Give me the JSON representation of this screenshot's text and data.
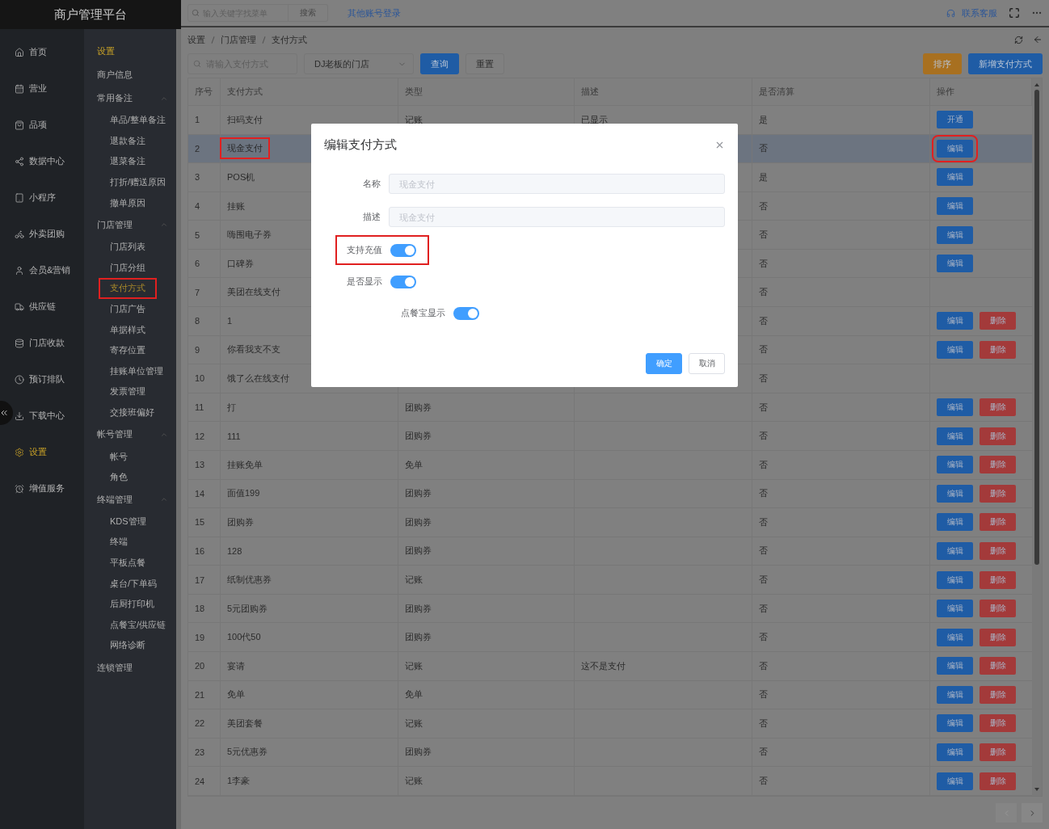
{
  "app_title": "商户管理平台",
  "nav": [
    {
      "label": "首页",
      "selected": false
    },
    {
      "label": "营业",
      "selected": false
    },
    {
      "label": "品项",
      "selected": false
    },
    {
      "label": "数据中心",
      "selected": false
    },
    {
      "label": "小程序",
      "selected": false
    },
    {
      "label": "外卖团购",
      "selected": false
    },
    {
      "label": "会员&营销",
      "selected": false
    },
    {
      "label": "供应链",
      "selected": false
    },
    {
      "label": "门店收款",
      "selected": false
    },
    {
      "label": "预订排队",
      "selected": false
    },
    {
      "label": "下载中心",
      "selected": false
    },
    {
      "label": "设置",
      "selected": true
    },
    {
      "label": "增值服务",
      "selected": false
    }
  ],
  "submenu": {
    "title": "设置",
    "items": [
      {
        "label": "商户信息"
      },
      {
        "label": "常用备注",
        "expanded": true,
        "children": [
          {
            "label": "单品/整单备注",
            "selected": false,
            "highlighted": false
          },
          {
            "label": "退款备注",
            "selected": false,
            "highlighted": false
          },
          {
            "label": "退菜备注",
            "selected": false,
            "highlighted": false
          },
          {
            "label": "打折/赠送原因",
            "selected": false,
            "highlighted": false
          },
          {
            "label": "撤单原因",
            "selected": false,
            "highlighted": false
          }
        ]
      },
      {
        "label": "门店管理",
        "expanded": true,
        "children": [
          {
            "label": "门店列表",
            "selected": false,
            "highlighted": false
          },
          {
            "label": "门店分组",
            "selected": false,
            "highlighted": false
          },
          {
            "label": "支付方式",
            "selected": true,
            "highlighted": true
          },
          {
            "label": "门店广告",
            "selected": false,
            "highlighted": false
          },
          {
            "label": "单据样式",
            "selected": false,
            "highlighted": false
          },
          {
            "label": "寄存位置",
            "selected": false,
            "highlighted": false
          },
          {
            "label": "挂账单位管理",
            "selected": false,
            "highlighted": false
          },
          {
            "label": "发票管理",
            "selected": false,
            "highlighted": false
          },
          {
            "label": "交接班偏好",
            "selected": false,
            "highlighted": false
          }
        ]
      },
      {
        "label": "帐号管理",
        "expanded": true,
        "children": [
          {
            "label": "帐号",
            "selected": false,
            "highlighted": false
          },
          {
            "label": "角色",
            "selected": false,
            "highlighted": false
          }
        ]
      },
      {
        "label": "终端管理",
        "expanded": true,
        "children": [
          {
            "label": "KDS管理",
            "selected": false,
            "highlighted": false
          },
          {
            "label": "终端",
            "selected": false,
            "highlighted": false
          },
          {
            "label": "平板点餐",
            "selected": false,
            "highlighted": false
          },
          {
            "label": "桌台/下单码",
            "selected": false,
            "highlighted": false
          },
          {
            "label": "后厨打印机",
            "selected": false,
            "highlighted": false
          },
          {
            "label": "点餐宝/供应链",
            "selected": false,
            "highlighted": false
          },
          {
            "label": "网络诊断",
            "selected": false,
            "highlighted": false
          }
        ]
      },
      {
        "label": "连锁管理"
      }
    ]
  },
  "topbar": {
    "search_placeholder": "输入关键字找菜单",
    "search_button": "搜索",
    "switch_account": "其他账号登录",
    "service": "联系客服"
  },
  "breadcrumb": [
    "设置",
    "门店管理",
    "支付方式"
  ],
  "filters": {
    "search_placeholder": "请输入支付方式",
    "store": "DJ老板的门店",
    "query_button": "查询",
    "reset_button": "重置",
    "sort_button": "排序",
    "add_button": "新增支付方式"
  },
  "table": {
    "columns": [
      "序号",
      "支付方式",
      "类型",
      "描述",
      "是否清算",
      "操作"
    ],
    "rows": [
      {
        "no": "1",
        "name": "扫码支付",
        "type": "记账",
        "desc": "已显示",
        "settle": "是",
        "selected": false,
        "highlighted": false,
        "actions": [
          {
            "label": "开通",
            "kind": "edit"
          }
        ]
      },
      {
        "no": "2",
        "name": "现金支付",
        "settle": "否",
        "selected": true,
        "highlighted": true,
        "actions": [
          {
            "label": "编辑",
            "kind": "edit"
          }
        ]
      },
      {
        "no": "3",
        "name": "POS机",
        "settle": "是",
        "selected": false,
        "highlighted": false,
        "actions": [
          {
            "label": "编辑",
            "kind": "edit"
          }
        ]
      },
      {
        "no": "4",
        "name": "挂账",
        "settle": "否",
        "selected": false,
        "highlighted": false,
        "actions": [
          {
            "label": "编辑",
            "kind": "edit"
          }
        ]
      },
      {
        "no": "5",
        "name": "嗨围电子券",
        "settle": "否",
        "selected": false,
        "highlighted": false,
        "actions": [
          {
            "label": "编辑",
            "kind": "edit"
          }
        ]
      },
      {
        "no": "6",
        "name": "口碑券",
        "settle": "否",
        "selected": false,
        "highlighted": false,
        "actions": [
          {
            "label": "编辑",
            "kind": "edit"
          }
        ]
      },
      {
        "no": "7",
        "name": "美团在线支付",
        "settle": "否",
        "selected": false,
        "highlighted": false,
        "actions": []
      },
      {
        "no": "8",
        "name": "1",
        "settle": "否",
        "selected": false,
        "highlighted": false,
        "actions": [
          {
            "label": "编辑",
            "kind": "edit"
          },
          {
            "label": "删除",
            "kind": "delete"
          }
        ]
      },
      {
        "no": "9",
        "name": "你看我支不支",
        "settle": "否",
        "selected": false,
        "highlighted": false,
        "actions": [
          {
            "label": "编辑",
            "kind": "edit"
          },
          {
            "label": "删除",
            "kind": "delete"
          }
        ]
      },
      {
        "no": "10",
        "name": "饿了么在线支付",
        "settle": "否",
        "selected": false,
        "highlighted": false,
        "actions": []
      },
      {
        "no": "11",
        "name": "打",
        "type": "团购券",
        "settle": "否",
        "selected": false,
        "highlighted": false,
        "actions": [
          {
            "label": "编辑",
            "kind": "edit"
          },
          {
            "label": "删除",
            "kind": "delete"
          }
        ]
      },
      {
        "no": "12",
        "name": "111",
        "type": "团购券",
        "settle": "否",
        "selected": false,
        "highlighted": false,
        "actions": [
          {
            "label": "编辑",
            "kind": "edit"
          },
          {
            "label": "删除",
            "kind": "delete"
          }
        ]
      },
      {
        "no": "13",
        "name": "挂账免单",
        "type": "免单",
        "settle": "否",
        "selected": false,
        "highlighted": false,
        "actions": [
          {
            "label": "编辑",
            "kind": "edit"
          },
          {
            "label": "删除",
            "kind": "delete"
          }
        ]
      },
      {
        "no": "14",
        "name": "面值199",
        "type": "团购券",
        "settle": "否",
        "selected": false,
        "highlighted": false,
        "actions": [
          {
            "label": "编辑",
            "kind": "edit"
          },
          {
            "label": "删除",
            "kind": "delete"
          }
        ]
      },
      {
        "no": "15",
        "name": "团购券",
        "type": "团购券",
        "settle": "否",
        "selected": false,
        "highlighted": false,
        "actions": [
          {
            "label": "编辑",
            "kind": "edit"
          },
          {
            "label": "删除",
            "kind": "delete"
          }
        ]
      },
      {
        "no": "16",
        "name": "128",
        "type": "团购券",
        "settle": "否",
        "selected": false,
        "highlighted": false,
        "actions": [
          {
            "label": "编辑",
            "kind": "edit"
          },
          {
            "label": "删除",
            "kind": "delete"
          }
        ]
      },
      {
        "no": "17",
        "name": "纸制优惠券",
        "type": "记账",
        "settle": "否",
        "selected": false,
        "highlighted": false,
        "actions": [
          {
            "label": "编辑",
            "kind": "edit"
          },
          {
            "label": "删除",
            "kind": "delete"
          }
        ]
      },
      {
        "no": "18",
        "name": "5元团购券",
        "type": "团购券",
        "settle": "否",
        "selected": false,
        "highlighted": false,
        "actions": [
          {
            "label": "编辑",
            "kind": "edit"
          },
          {
            "label": "删除",
            "kind": "delete"
          }
        ]
      },
      {
        "no": "19",
        "name": "100代50",
        "type": "团购券",
        "settle": "否",
        "selected": false,
        "highlighted": false,
        "actions": [
          {
            "label": "编辑",
            "kind": "edit"
          },
          {
            "label": "删除",
            "kind": "delete"
          }
        ]
      },
      {
        "no": "20",
        "name": "宴请",
        "type": "记账",
        "desc": "这不是支付",
        "settle": "否",
        "selected": false,
        "highlighted": false,
        "actions": [
          {
            "label": "编辑",
            "kind": "edit"
          },
          {
            "label": "删除",
            "kind": "delete"
          }
        ]
      },
      {
        "no": "21",
        "name": "免单",
        "type": "免单",
        "settle": "否",
        "selected": false,
        "highlighted": false,
        "actions": [
          {
            "label": "编辑",
            "kind": "edit"
          },
          {
            "label": "删除",
            "kind": "delete"
          }
        ]
      },
      {
        "no": "22",
        "name": "美团套餐",
        "type": "记账",
        "settle": "否",
        "selected": false,
        "highlighted": false,
        "actions": [
          {
            "label": "编辑",
            "kind": "edit"
          },
          {
            "label": "删除",
            "kind": "delete"
          }
        ]
      },
      {
        "no": "23",
        "name": "5元优惠券",
        "type": "团购券",
        "settle": "否",
        "selected": false,
        "highlighted": false,
        "actions": [
          {
            "label": "编辑",
            "kind": "edit"
          },
          {
            "label": "删除",
            "kind": "delete"
          }
        ]
      },
      {
        "no": "24",
        "name": "1李豪",
        "type": "记账",
        "settle": "否",
        "selected": false,
        "highlighted": false,
        "actions": [
          {
            "label": "编辑",
            "kind": "edit"
          },
          {
            "label": "删除",
            "kind": "delete"
          }
        ]
      }
    ]
  },
  "modal": {
    "title": "编辑支付方式",
    "fields": [
      {
        "kind": "text",
        "label": "名称",
        "placeholder": "现金支付"
      },
      {
        "kind": "text",
        "label": "描述",
        "placeholder": "现金支付"
      },
      {
        "kind": "switch",
        "label": "支持充值",
        "on": true,
        "highlighted": true
      },
      {
        "kind": "switch",
        "label": "是否显示",
        "on": true,
        "highlighted": false
      }
    ],
    "extra_switch": {
      "label": "点餐宝显示",
      "on": true
    },
    "confirm": "确定",
    "cancel": "取消"
  }
}
